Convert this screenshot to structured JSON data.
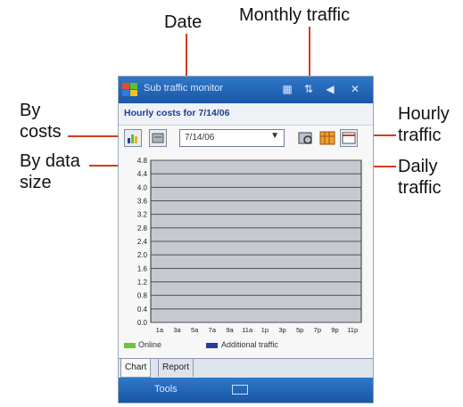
{
  "callouts": {
    "date": "Date",
    "monthly": "Monthly traffic",
    "by_costs_1": "By",
    "by_costs_2": "costs",
    "hourly_1": "Hourly",
    "hourly_2": "traffic",
    "by_data_1": "By data",
    "by_data_2": "size",
    "daily_1": "Daily",
    "daily_2": "traffic"
  },
  "app": {
    "title": "Sub traffic monitor",
    "subtitle": "Hourly costs for 7/14/06",
    "date_value": "7/14/06"
  },
  "legend": {
    "online": "Online",
    "additional": "Additional traffic"
  },
  "tabs": {
    "chart": "Chart",
    "report": "Report"
  },
  "menu": {
    "tools": "Tools"
  },
  "colors": {
    "online": "#6dc63a",
    "additional": "#2a3b98",
    "accent": "#d23a1f"
  },
  "chart_data": {
    "type": "bar",
    "title": "",
    "xlabel": "",
    "ylabel": "",
    "y_ticks": [
      "4.8",
      "4.4",
      "4.0",
      "3.6",
      "3.2",
      "2.8",
      "2.4",
      "2.0",
      "1.6",
      "1.2",
      "0.8",
      "0.4",
      "0.0"
    ],
    "ylim": [
      0,
      4.8
    ],
    "categories": [
      "1a",
      "3a",
      "5a",
      "7a",
      "9a",
      "11a",
      "1p",
      "3p",
      "5p",
      "7p",
      "9p",
      "11p"
    ],
    "x_labels": [
      "1a",
      "3a",
      "5a",
      "7a",
      "9a",
      "11a",
      "1p",
      "3p",
      "5p",
      "7p",
      "9p",
      "11p"
    ],
    "series": [
      {
        "name": "Online",
        "values": [
          0,
          0,
          0,
          0,
          0,
          0,
          0,
          0,
          0,
          0,
          0,
          0
        ]
      },
      {
        "name": "Additional traffic",
        "values": [
          0,
          0,
          0,
          0,
          0,
          0,
          0,
          0,
          0,
          0,
          0,
          0
        ]
      }
    ],
    "grid": true,
    "legend": "bottom"
  }
}
